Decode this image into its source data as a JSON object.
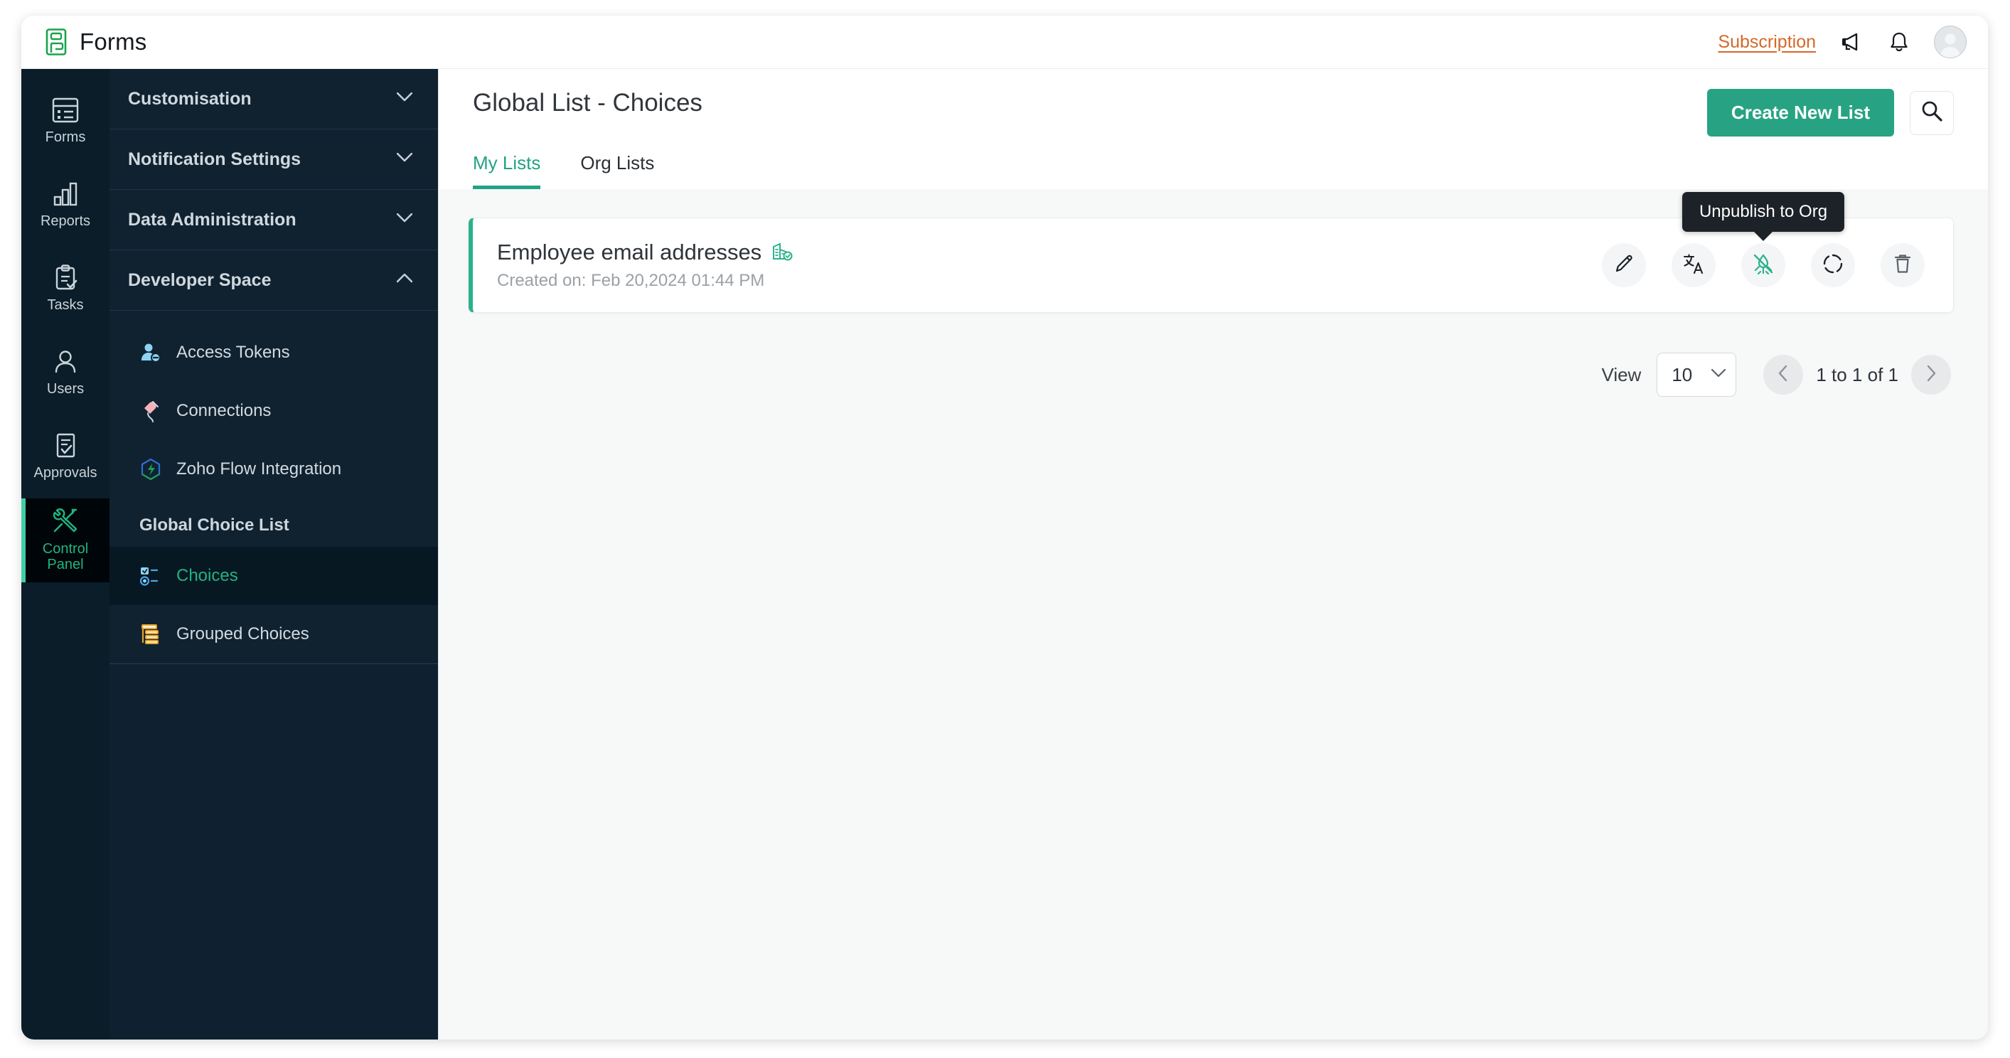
{
  "topbar": {
    "brand_name": "Forms",
    "brand_logo_icon": "forms-logo-icon",
    "subscription_label": "Subscription",
    "announcement_icon": "megaphone-icon",
    "notification_icon": "bell-icon",
    "avatar_icon": "user-avatar-icon"
  },
  "rail": {
    "items": [
      {
        "label": "Forms",
        "icon": "forms-icon",
        "active": false
      },
      {
        "label": "Reports",
        "icon": "bar-chart-icon",
        "active": false
      },
      {
        "label": "Tasks",
        "icon": "clipboard-check-icon",
        "active": false
      },
      {
        "label": "Users",
        "icon": "person-icon",
        "active": false
      },
      {
        "label": "Approvals",
        "icon": "document-check-icon",
        "active": false
      },
      {
        "label": "Control\nPanel",
        "label_line1": "Control",
        "label_line2": "Panel",
        "icon": "tools-icon",
        "active": true
      }
    ]
  },
  "sidebar": {
    "sections": [
      {
        "label": "Customisation",
        "expanded": false,
        "chevron": "chevron-down-icon"
      },
      {
        "label": "Notification Settings",
        "expanded": false,
        "chevron": "chevron-down-icon"
      },
      {
        "label": "Data Administration",
        "expanded": false,
        "chevron": "chevron-down-icon"
      },
      {
        "label": "Developer Space",
        "expanded": true,
        "chevron": "chevron-up-icon"
      }
    ],
    "items": [
      {
        "label": "Access Tokens",
        "icon": "access-token-person-icon",
        "active": false
      },
      {
        "label": "Connections",
        "icon": "plug-connection-icon",
        "active": false
      },
      {
        "label": "Zoho Flow Integration",
        "icon": "zoho-flow-icon",
        "active": false
      }
    ],
    "group_title": "Global Choice List",
    "group_items": [
      {
        "label": "Choices",
        "icon": "choices-icon",
        "active": true
      },
      {
        "label": "Grouped Choices",
        "icon": "grouped-choices-icon",
        "active": false
      }
    ]
  },
  "main": {
    "page_title": "Global List - Choices",
    "create_button": "Create New List",
    "search_icon": "search-icon",
    "tabs": [
      {
        "label": "My Lists",
        "active": true
      },
      {
        "label": "Org Lists",
        "active": false
      }
    ],
    "list": [
      {
        "title": "Employee email addresses",
        "org_badge_icon": "org-published-building-icon",
        "subtitle": "Created on: Feb 20,2024 01:44 PM",
        "actions": [
          {
            "name": "edit",
            "icon": "pencil-icon"
          },
          {
            "name": "translate",
            "icon": "translate-icon"
          },
          {
            "name": "unpublish",
            "icon": "unpublish-icon",
            "highlighted": true
          },
          {
            "name": "sync",
            "icon": "sync-circle-icon"
          },
          {
            "name": "delete",
            "icon": "trash-icon"
          }
        ]
      }
    ],
    "tooltip": "Unpublish to Org",
    "pagination": {
      "view_label": "View",
      "page_size": "10",
      "page_size_chevron": "chevron-down-icon",
      "range": "1 to 1 of 1",
      "prev_icon": "chevron-left-icon",
      "next_icon": "chevron-right-icon"
    }
  },
  "colors": {
    "accent_green": "#27a383",
    "link_orange": "#d4682a",
    "rail_bg": "#0b1d28",
    "sidebar_bg": "#102230",
    "card_border_green": "#2bb28d",
    "tooltip_bg": "#1d2228"
  }
}
